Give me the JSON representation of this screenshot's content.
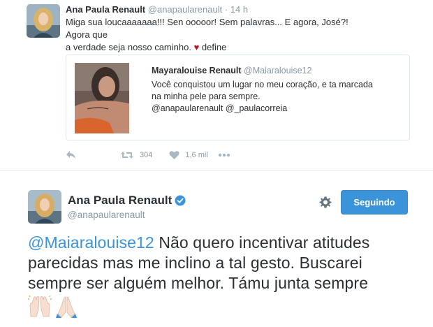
{
  "top_tweet": {
    "author_name": "Ana Paula Renault",
    "author_handle": "@anapaularenault",
    "separator": "·",
    "time": "14 h",
    "text_line1": "Miga sua loucaaaaaaa!!! Sen ooooor! Sem palavras... E agora, José?! Agora que",
    "text_line2": "a verdade seja nosso caminho.",
    "heart_emoji": "♥",
    "text_suffix": "define",
    "quote": {
      "author_name": "Mayaralouise Renault",
      "author_handle": "@Maiaralouise12",
      "text_line1": "Você conquistou um lugar no meu coração, e ta marcada",
      "text_line2": "na minha pele para  sempre.",
      "text_line3": "@anapaularenault @_paulacorreia"
    },
    "actions": {
      "retweet_count": "304",
      "like_count": "1,6 mil"
    }
  },
  "main_tweet": {
    "author_name": "Ana Paula Renault",
    "author_handle": "@anapaularenault",
    "follow_button_label": "Seguindo",
    "mention": "@Maiaralouise12",
    "text_line1_rest": " Não quero incentivar atitudes",
    "text_line2": "parecidas mas me inclino a tal gesto. Buscarei",
    "text_line3": "sempre ser alguém melhor. Támu junta sempre"
  },
  "colors": {
    "accent": "#3b94d9",
    "muted": "#8899a6",
    "text": "#292f33",
    "heart": "#c0162a"
  }
}
